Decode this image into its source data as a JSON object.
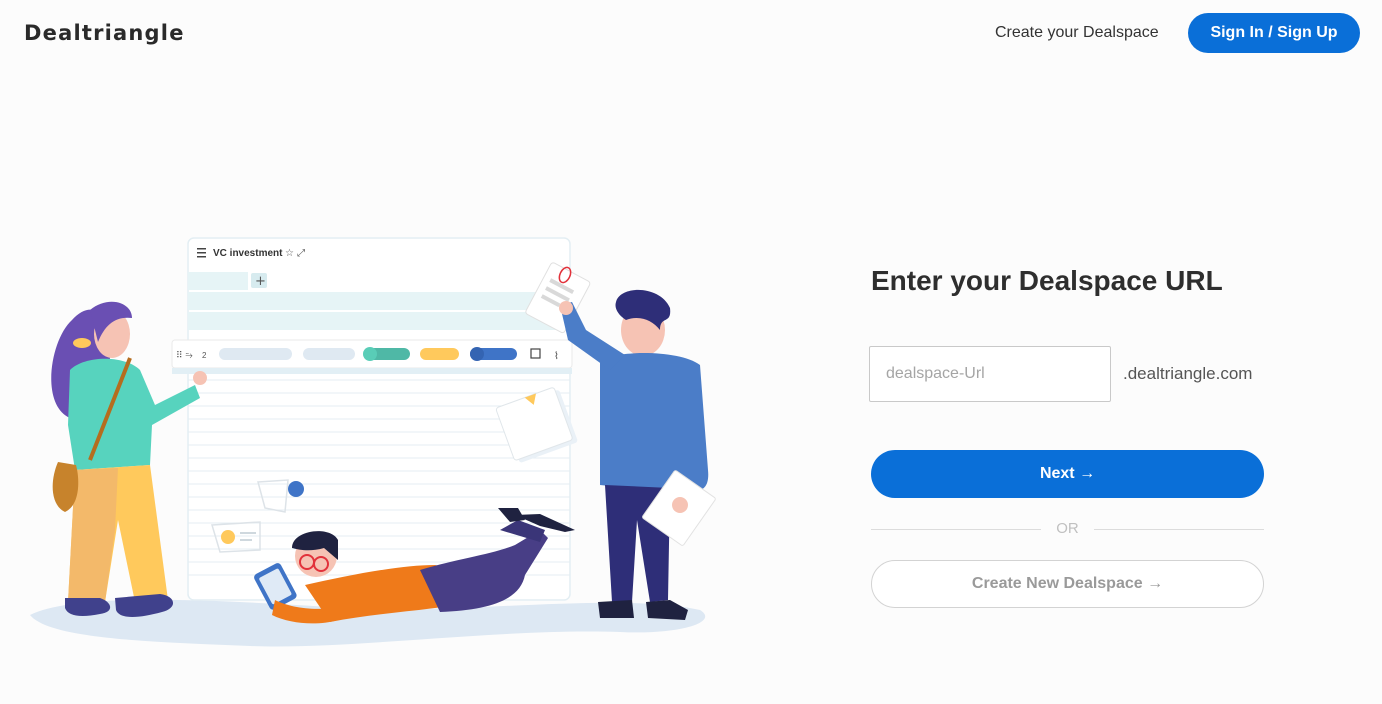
{
  "header": {
    "logo_text": "Dealtriangle",
    "create_link": "Create your Dealspace",
    "signin_button": "Sign In / Sign Up"
  },
  "illustration": {
    "board_title": "VC investment",
    "toolbar_count": "2"
  },
  "form": {
    "title": "Enter your Dealspace URL",
    "url_input": {
      "value": "",
      "placeholder": "dealspace-Url"
    },
    "domain_suffix": ".dealtriangle.com",
    "next_button": "Next →",
    "or_text": "OR",
    "create_button": "Create New Dealspace →"
  },
  "colors": {
    "primary": "#0a6fd8",
    "background": "#fcfcfc",
    "teal": "#4fc9b0",
    "yellow": "#ffc95c",
    "blue": "#3f74c7",
    "orange": "#ef7a1a",
    "purple": "#6a4fb3"
  }
}
